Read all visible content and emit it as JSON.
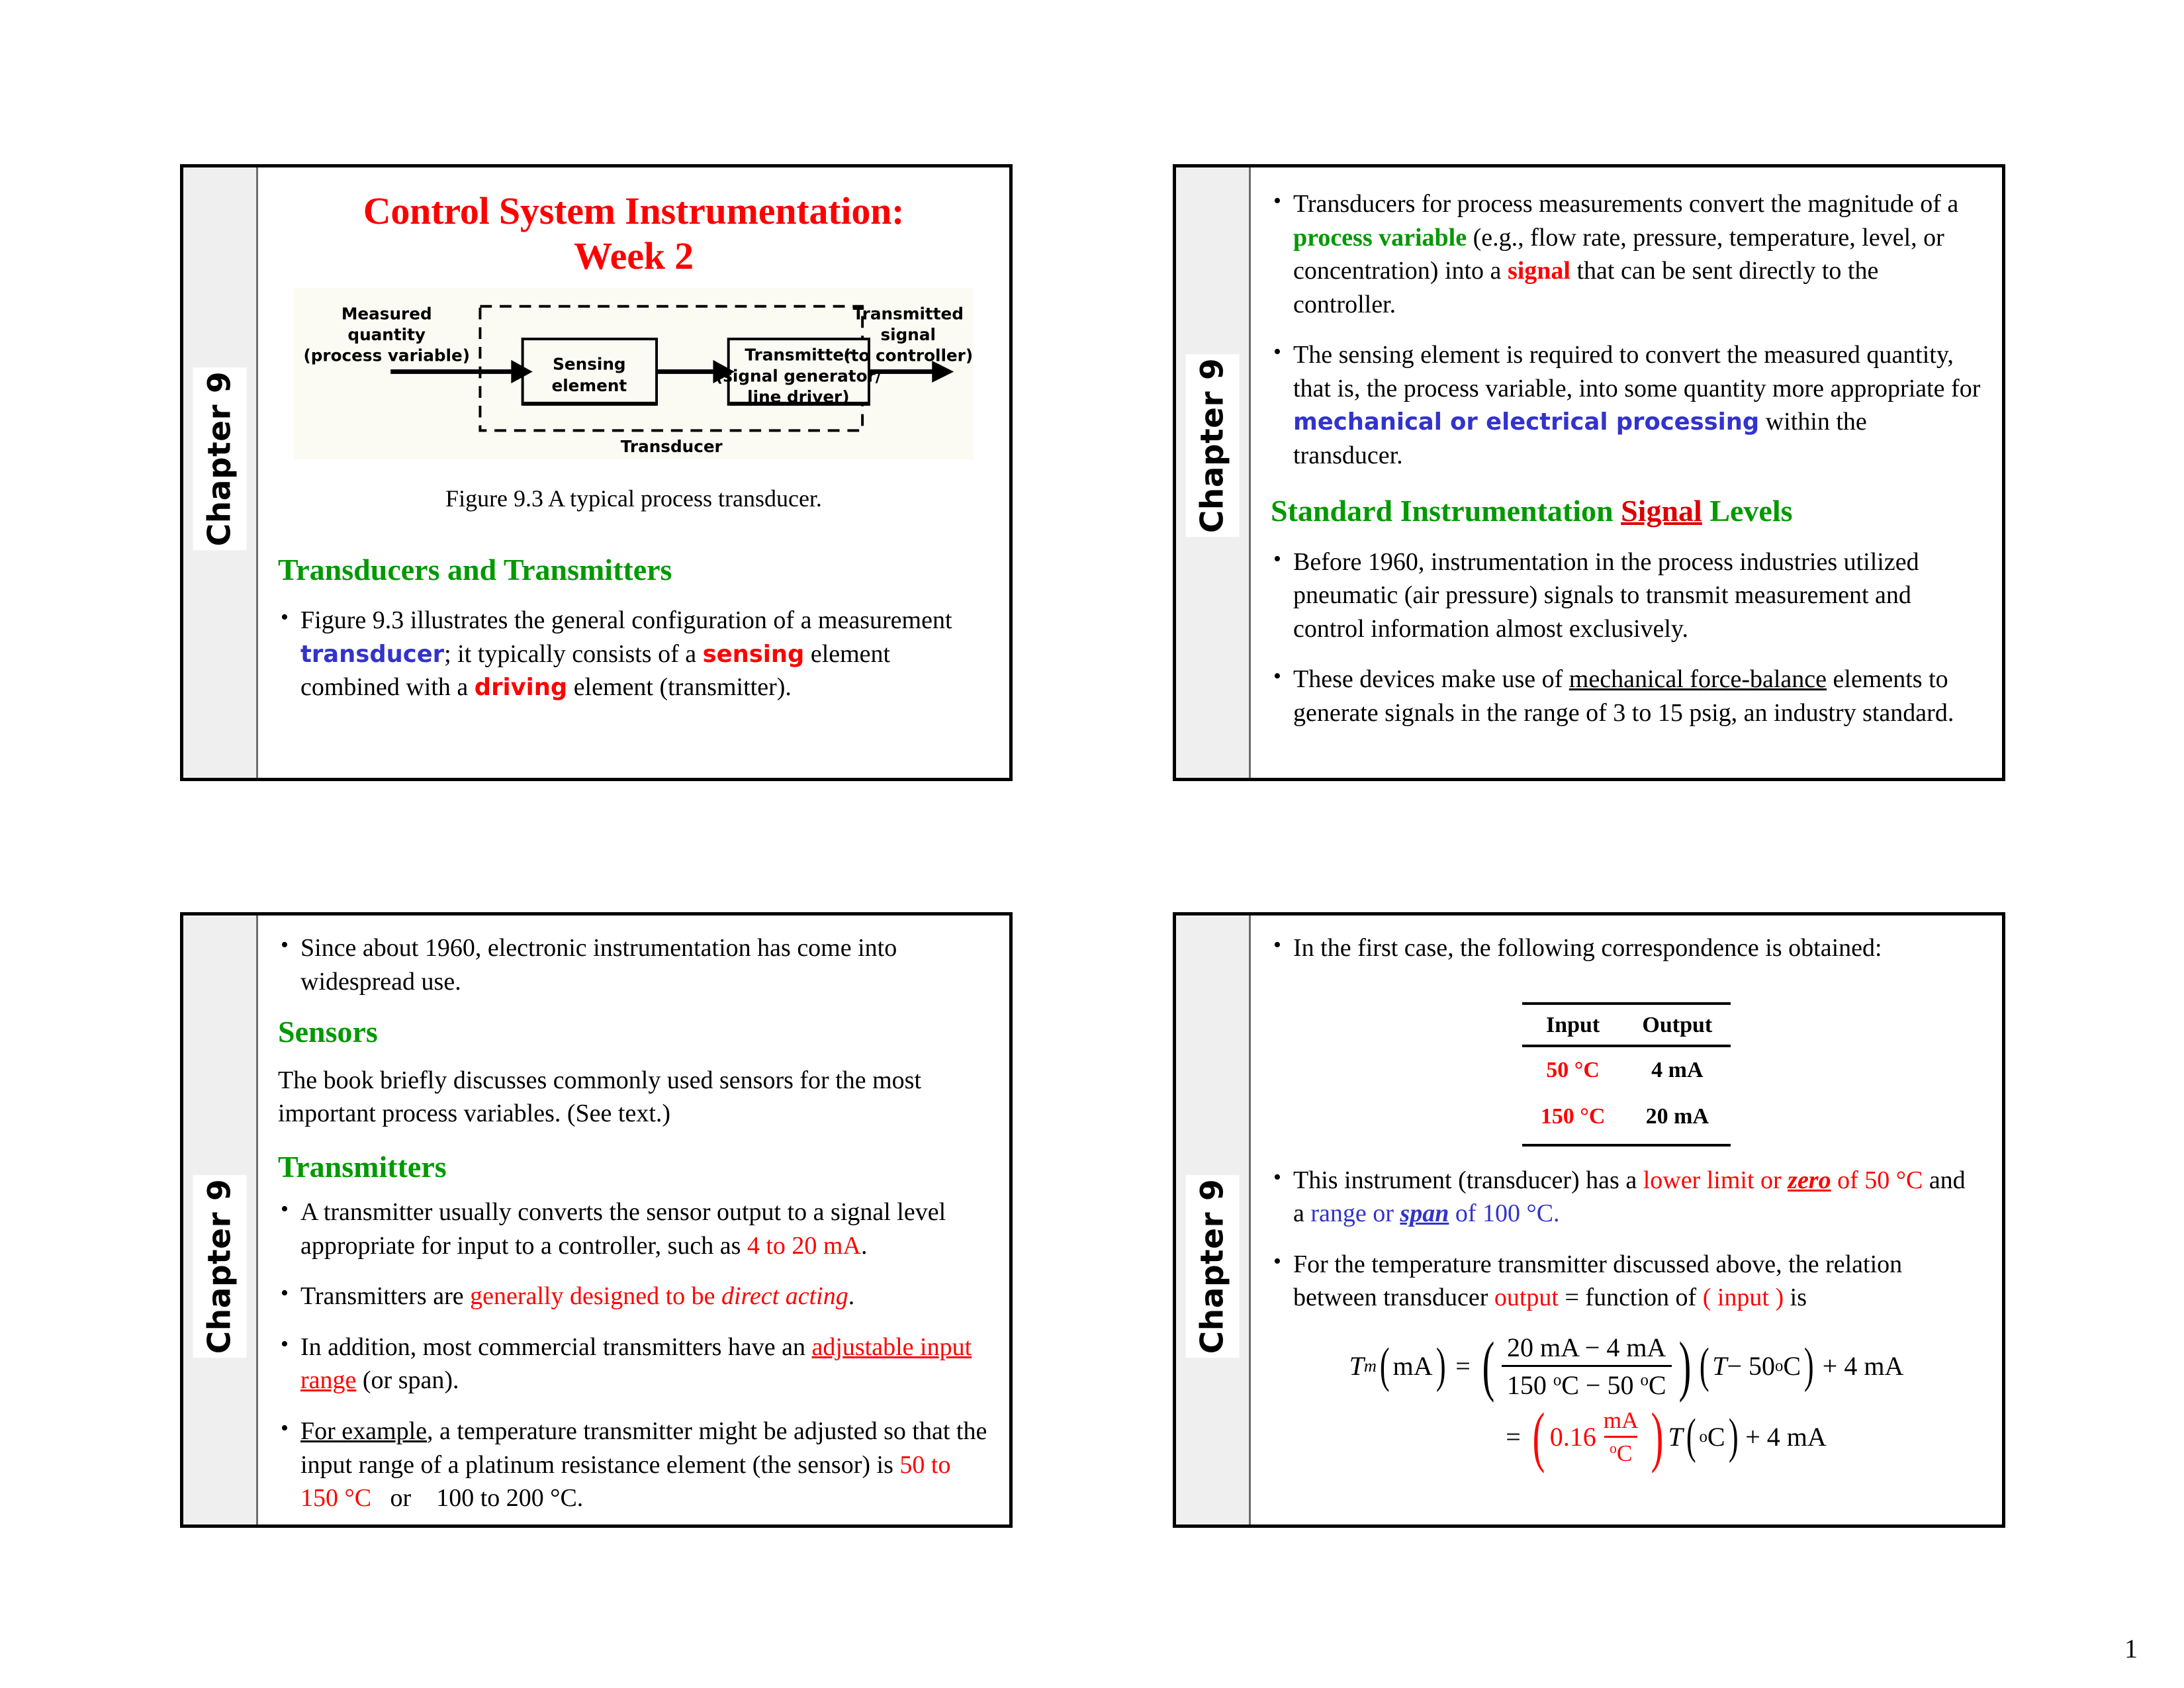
{
  "document": {
    "page_number": "1"
  },
  "colors": {
    "title_red": "#ff0000",
    "heading_green": "#009900",
    "accent_blue": "#3333cc",
    "accent_red": "#ff0000",
    "sidebar_gray": "#efefef"
  },
  "slides": [
    {
      "id": "slide-1",
      "chapter_label": "Chapter 9",
      "title_line1": "Control System Instrumentation:",
      "title_line2": "Week 2",
      "figure": {
        "caption": "Figure 9.3 A typical process transducer.",
        "label_left_line1": "Measured",
        "label_left_line2": "quantity",
        "label_left_line3": "(process variable)",
        "label_right_line1": "Transmitted",
        "label_right_line2": "signal",
        "label_right_line3": "(to controller)",
        "box1_line1": "Sensing",
        "box1_line2": "element",
        "box2_line1": "Transmitter",
        "box2_line2": "(signal generator/",
        "box2_line3": "line driver)",
        "dashed_label": "Transducer"
      },
      "heading": "Transducers and Transmitters",
      "bullet1": {
        "part1": "Figure 9.3 illustrates the general configuration of a measurement ",
        "word_transducer": "transducer",
        "part2": "; it typically consists of a ",
        "word_sensing": "sensing",
        "part3": " element combined with a ",
        "word_driving": "driving",
        "part4": " element (transmitter)."
      }
    },
    {
      "id": "slide-2",
      "chapter_label": "Chapter 9",
      "bullet1": {
        "part1": "Transducers for process measurements convert the magnitude of a ",
        "word_process_variable": "process variable",
        "part2": " (e.g., flow rate, pressure, temperature, level, or concentration) into a ",
        "word_signal": "signal",
        "part3": " that can be sent directly to the controller."
      },
      "bullet2": {
        "part1": "The sensing element is required to convert the measured quantity, that is, the process variable, into some quantity more appropriate for ",
        "word_mech_elec": "mechanical or electrical processing",
        "part2": " within the transducer."
      },
      "heading_part1": "Standard Instrumentation ",
      "heading_signal": "Signal",
      "heading_part2": " Levels",
      "bullet3": "Before 1960, instrumentation in the process industries utilized pneumatic (air pressure) signals to transmit measurement and control information almost exclusively.",
      "bullet4": {
        "part1": "These devices make use of ",
        "word_force_balance": "mechanical force-balance",
        "part2": " elements to generate signals in the range of 3 to 15 psig, an industry standard."
      }
    },
    {
      "id": "slide-3",
      "chapter_label": "Chapter 9",
      "bullet1": "Since about 1960, electronic instrumentation has come into widespread use.",
      "heading_sensors": "Sensors",
      "sensors_text": "The book briefly discusses commonly used sensors for the most important process variables. (See text.)",
      "heading_transmitters": "Transmitters",
      "bullet2": {
        "part1": "A transmitter usually converts the sensor output to a signal level appropriate for input to a controller, such as ",
        "word_range": "4 to 20 mA",
        "part2": "."
      },
      "bullet3": {
        "part1": "Transmitters are ",
        "word_generally": "generally designed to be ",
        "word_direct_acting": "direct acting",
        "part2": "."
      },
      "bullet4": {
        "part1": "In addition, most commercial transmitters have an ",
        "word_adjustable": "adjustable input range",
        "part2": " (or span)."
      },
      "bullet5": {
        "word_for_example": "For example",
        "part1": ", a temperature transmitter might be adjusted so that the input range of a platinum resistance element (the sensor) is ",
        "word_range1": "50 to 150 °C",
        "part2": "   or    100 to 200 °C."
      }
    },
    {
      "id": "slide-4",
      "chapter_label": "Chapter 9",
      "bullet1": "In the first case, the following correspondence is obtained:",
      "table": {
        "headers": [
          "Input",
          "Output"
        ],
        "rows": [
          [
            "50 °C",
            "4 mA"
          ],
          [
            "150 °C",
            "20 mA"
          ]
        ]
      },
      "bullet2": {
        "part1": "This instrument (transducer) has a ",
        "word_lower_limit": "lower limit or ",
        "word_zero": "zero",
        "part2": " of 50 °C",
        "part3": " and a ",
        "word_range": "range or ",
        "word_span": "span",
        "part4": " of 100 °C."
      },
      "bullet3": {
        "part1": "For the temperature transmitter discussed above, the relation between transducer ",
        "word_output": "output",
        "part2": " = function of ",
        "word_input": "( input )",
        "part3": " is"
      },
      "equation1": {
        "lhs_var": "T",
        "lhs_sub": "m",
        "lhs_units": "mA",
        "frac_num": "20 mA − 4 mA",
        "frac_den_a": "150 ",
        "frac_den_b": "C − 50 ",
        "frac_den_c": "C",
        "term_var": "T",
        "term_rest": " − 50 ",
        "term_unit": "C",
        "tail": "+ 4 mA"
      },
      "equation2": {
        "coefficient": "0.16",
        "frac_num": "mA",
        "frac_den": "C",
        "var": "T",
        "var_unit": "C",
        "tail": "+ 4 mA"
      }
    }
  ]
}
